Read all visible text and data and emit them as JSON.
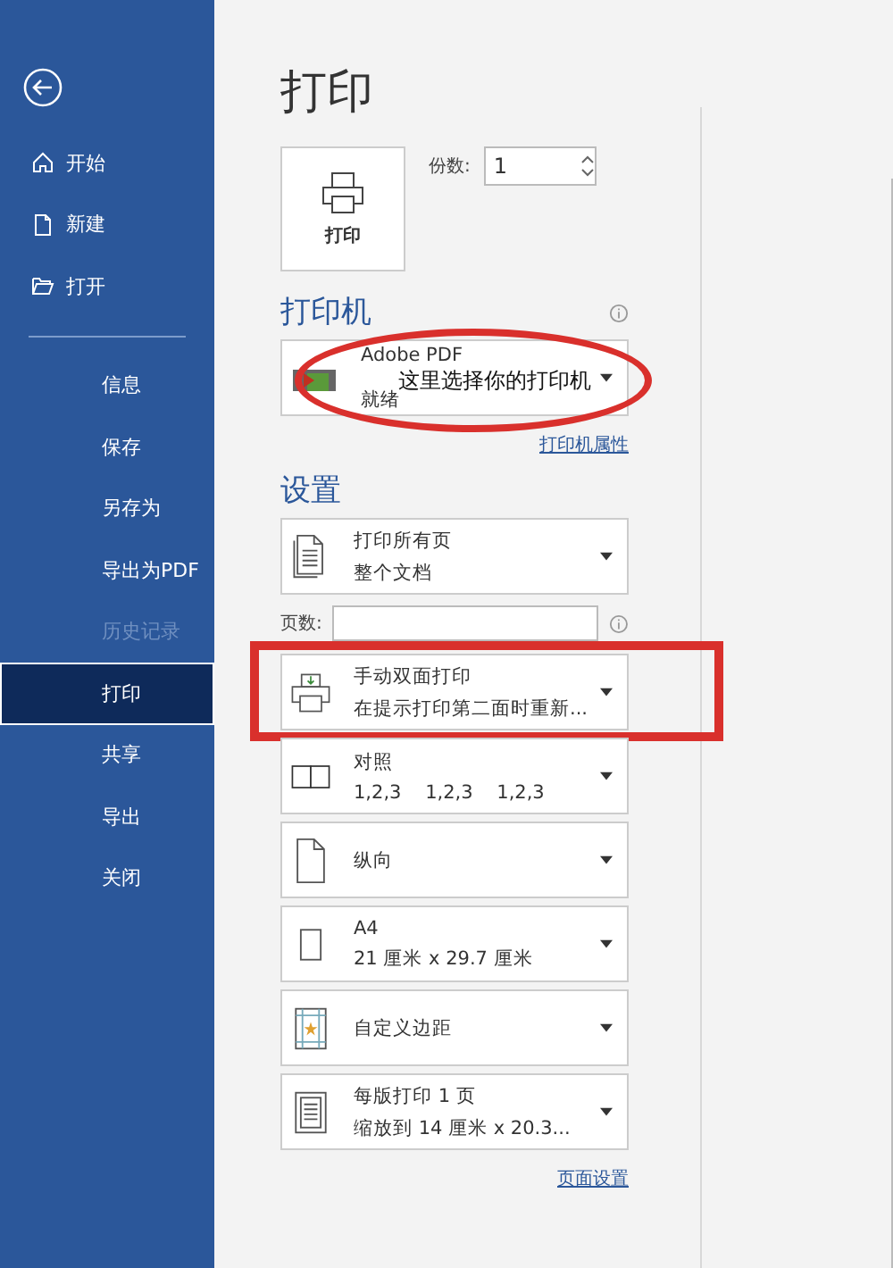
{
  "sidebar": {
    "items": [
      {
        "label": "开始",
        "kind": "home",
        "selected": false,
        "disabled": false
      },
      {
        "label": "新建",
        "kind": "new",
        "selected": false,
        "disabled": false
      },
      {
        "label": "打开",
        "kind": "open",
        "selected": false,
        "disabled": false
      },
      {
        "label": "信息",
        "kind": "plain",
        "selected": false,
        "disabled": false
      },
      {
        "label": "保存",
        "kind": "plain",
        "selected": false,
        "disabled": false
      },
      {
        "label": "另存为",
        "kind": "plain",
        "selected": false,
        "disabled": false
      },
      {
        "label": "导出为PDF",
        "kind": "plain",
        "selected": false,
        "disabled": false
      },
      {
        "label": "历史记录",
        "kind": "plain",
        "selected": false,
        "disabled": true
      },
      {
        "label": "打印",
        "kind": "plain",
        "selected": true,
        "disabled": false
      },
      {
        "label": "共享",
        "kind": "plain",
        "selected": false,
        "disabled": false
      },
      {
        "label": "导出",
        "kind": "plain",
        "selected": false,
        "disabled": false
      },
      {
        "label": "关闭",
        "kind": "plain",
        "selected": false,
        "disabled": false
      }
    ]
  },
  "title": "打印",
  "print_button": {
    "label": "打印"
  },
  "copies": {
    "label": "份数:",
    "value": "1"
  },
  "printer": {
    "heading": "打印机",
    "name": "Adobe PDF",
    "status": "就绪",
    "annotation": "这里选择你的打印机",
    "properties_link": "打印机属性"
  },
  "settings": {
    "heading": "设置",
    "pages_label": "页数:",
    "items": [
      {
        "kind": "pages",
        "title": "打印所有页",
        "subtitle": "整个文档",
        "highlighted": false
      },
      {
        "kind": "duplex",
        "title": "手动双面打印",
        "subtitle": "在提示打印第二面时重新...",
        "highlighted": true
      },
      {
        "kind": "collate",
        "title": "对照",
        "subtitle": "1,2,3    1,2,3    1,2,3",
        "highlighted": false
      },
      {
        "kind": "orientation",
        "title": "纵向",
        "highlighted": false
      },
      {
        "kind": "paper",
        "title": "A4",
        "subtitle": "21 厘米 x 29.7 厘米",
        "highlighted": false
      },
      {
        "kind": "margins",
        "title": "自定义边距",
        "highlighted": false
      },
      {
        "kind": "per-sheet",
        "title": "每版打印 1 页",
        "subtitle": "缩放到 14 厘米 x 20.3...",
        "highlighted": false
      }
    ],
    "page_setup_link": "页面设置"
  }
}
